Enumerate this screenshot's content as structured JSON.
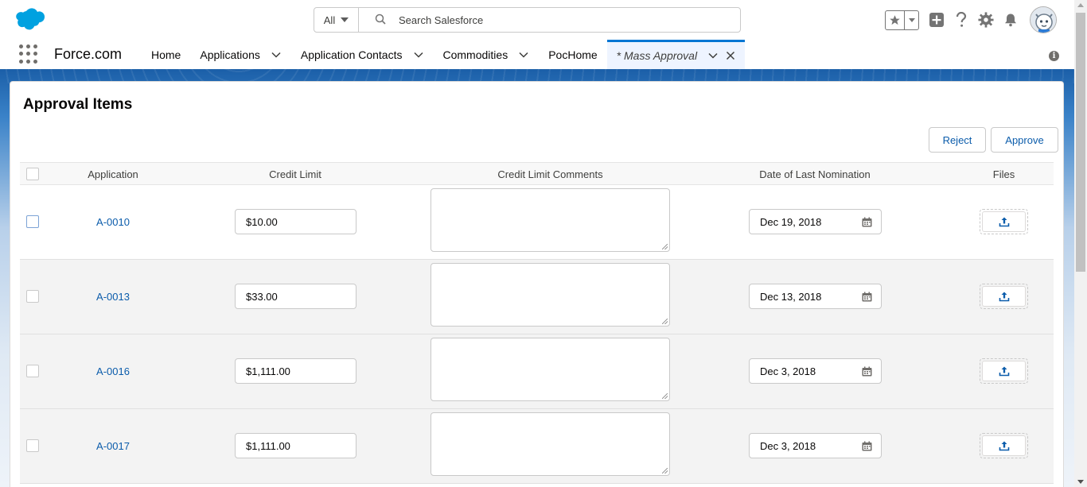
{
  "header": {
    "logo_icon": "salesforce-cloud-icon",
    "search_scope": "All",
    "search_placeholder": "Search Salesforce",
    "icons": [
      "favorites-star-icon",
      "add-icon",
      "help-icon",
      "setup-gear-icon",
      "notifications-bell-icon",
      "user-avatar"
    ]
  },
  "nav": {
    "app_name": "Force.com",
    "items": [
      {
        "label": "Home",
        "has_menu": false
      },
      {
        "label": "Applications",
        "has_menu": true
      },
      {
        "label": "Application Contacts",
        "has_menu": true
      },
      {
        "label": "Commodities",
        "has_menu": true
      },
      {
        "label": "PocHome",
        "has_menu": false
      },
      {
        "label": "* Mass Approval",
        "has_menu": true,
        "active": true,
        "closable": true
      }
    ]
  },
  "card": {
    "title": "Approval Items",
    "reject_label": "Reject",
    "approve_label": "Approve"
  },
  "table": {
    "columns": [
      "Application",
      "Credit Limit",
      "Credit Limit Comments",
      "Date of Last Nomination",
      "Files"
    ],
    "rows": [
      {
        "application": "A-0010",
        "credit_limit": "$10.00",
        "comments": "",
        "date": "Dec 19, 2018"
      },
      {
        "application": "A-0013",
        "credit_limit": "$33.00",
        "comments": "",
        "date": "Dec 13, 2018"
      },
      {
        "application": "A-0016",
        "credit_limit": "$1,111.00",
        "comments": "",
        "date": "Dec 3, 2018"
      },
      {
        "application": "A-0017",
        "credit_limit": "$1,111.00",
        "comments": "",
        "date": "Dec 3, 2018"
      }
    ]
  },
  "colors": {
    "brand_blue": "#0176d3",
    "link_blue": "#0b5cab",
    "active_tab_bg": "#eef4ff"
  }
}
